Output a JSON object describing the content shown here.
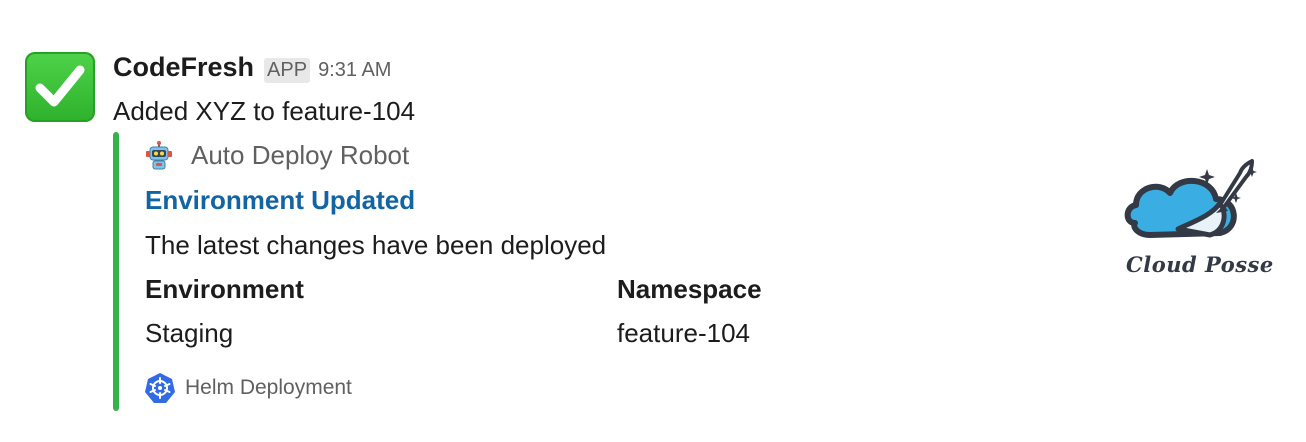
{
  "message": {
    "avatar_icon": "white-check-mark-icon",
    "sender": "CodeFresh",
    "badge": "APP",
    "time": "9:31 AM",
    "text": "Added XYZ to feature-104"
  },
  "attachment": {
    "bar_color": "#36b24a",
    "author_icon": "robot-icon",
    "author_name": "Auto Deploy Robot",
    "title": "Environment Updated",
    "title_color": "#1264a3",
    "text": "The latest changes have been deployed",
    "fields": [
      {
        "title": "Environment",
        "value": "Staging"
      },
      {
        "title": "Namespace",
        "value": "feature-104"
      }
    ],
    "footer_icon": "kubernetes-helm-icon",
    "footer": "Helm Deployment",
    "thumb": {
      "icon": "cloud-posse-logo",
      "text": "Cloud Posse"
    }
  }
}
